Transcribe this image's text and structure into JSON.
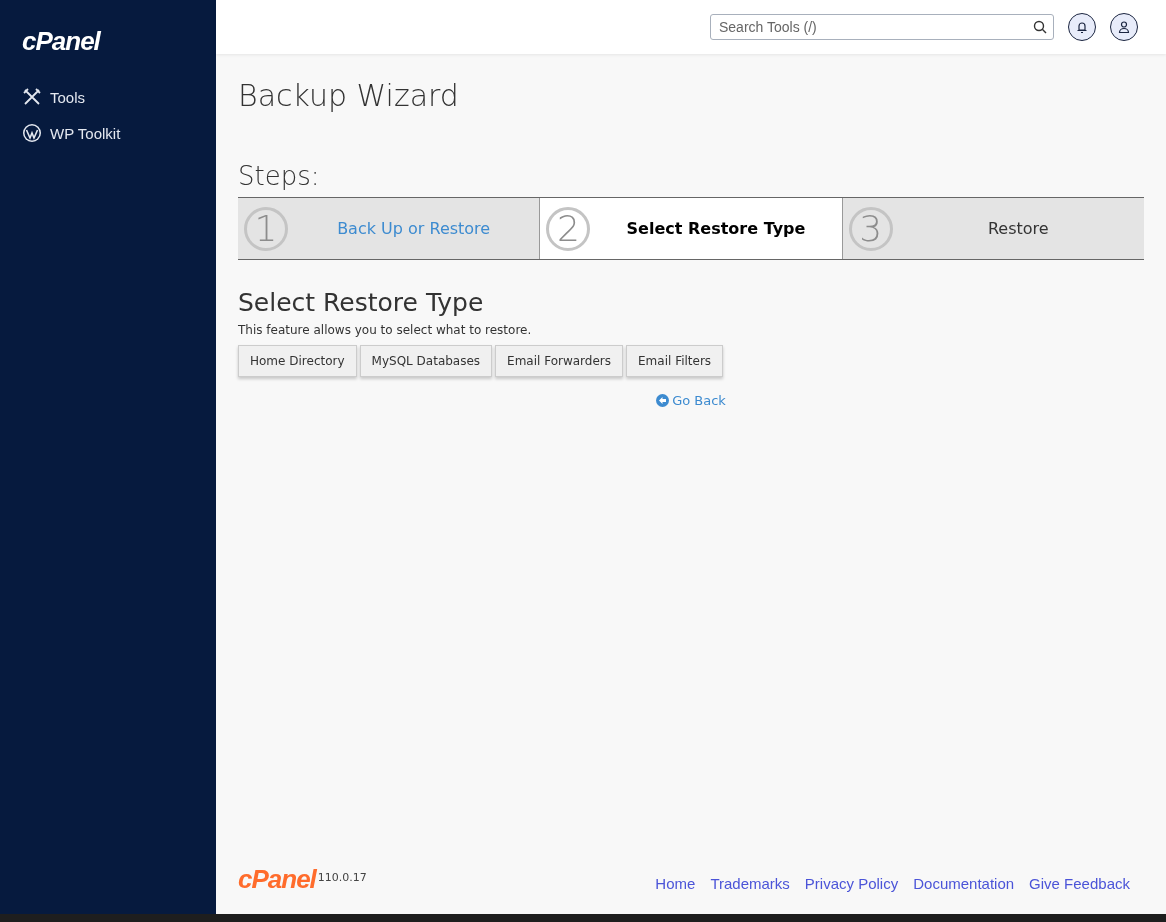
{
  "sidebar": {
    "logo": "cPanel",
    "items": [
      {
        "label": "Tools",
        "kind": "tools"
      },
      {
        "label": "WP Toolkit",
        "kind": "wordpress"
      }
    ]
  },
  "header": {
    "search": {
      "placeholder": "Search Tools (/)"
    }
  },
  "page_title": "Backup Wizard",
  "steps_heading": "Steps:",
  "steps": [
    {
      "number": "1",
      "label": "Back Up or Restore",
      "selected": false
    },
    {
      "number": "2",
      "label": "Select Restore Type",
      "selected": true
    },
    {
      "number": "3",
      "label": "Restore",
      "selected": false
    }
  ],
  "section": {
    "title": "Select Restore Type",
    "description": "This feature allows you to select what to restore.",
    "buttons": [
      "Home Directory",
      "MySQL Databases",
      "Email Forwarders",
      "Email Filters"
    ],
    "back_link": "Go Back"
  },
  "footer": {
    "logo": "cPanel",
    "version": "110.0.17",
    "links": [
      "Home",
      "Trademarks",
      "Privacy Policy",
      "Documentation",
      "Give Feedback"
    ]
  }
}
